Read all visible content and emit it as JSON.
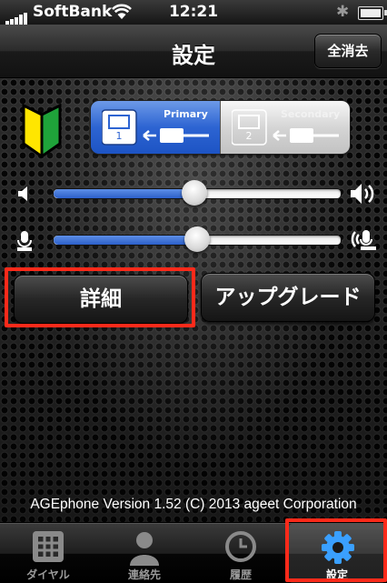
{
  "status_bar": {
    "carrier": "SoftBank",
    "time": "12:21"
  },
  "nav": {
    "title": "設定",
    "clear_button": "全消去"
  },
  "line_selector": {
    "options": [
      {
        "label": "Primary",
        "number": "1",
        "selected": true
      },
      {
        "label": "Secondary",
        "number": "2",
        "selected": false
      }
    ]
  },
  "volume": {
    "speaker_level": 0.49,
    "mic_level": 0.5
  },
  "buttons": {
    "details": "詳細",
    "upgrade": "アップグレード"
  },
  "footer": {
    "version": "AGEphone Version 1.52 (C) 2013 ageet Corporation"
  },
  "tabs": [
    {
      "label": "ダイヤル",
      "icon": "keypad-icon",
      "active": false
    },
    {
      "label": "連絡先",
      "icon": "contacts-icon",
      "active": false
    },
    {
      "label": "履歴",
      "icon": "clock-icon",
      "active": false
    },
    {
      "label": "設定",
      "icon": "gear-icon",
      "active": true
    }
  ],
  "colors": {
    "accent": "#2d64d2",
    "highlight": "#ff2a1a",
    "leaf_yellow": "#ffe600",
    "leaf_green": "#1fa33a"
  }
}
